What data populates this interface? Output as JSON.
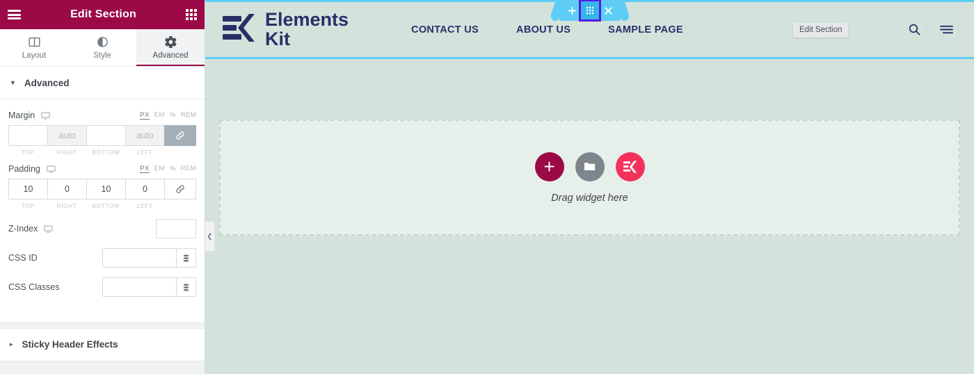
{
  "panel": {
    "header": {
      "title": "Edit Section",
      "menu_icon": "hamburger-icon",
      "widgets_icon": "grid-apps-icon"
    },
    "tabs": [
      {
        "label": "Layout",
        "icon": "columns-icon",
        "active": false
      },
      {
        "label": "Style",
        "icon": "contrast-icon",
        "active": false
      },
      {
        "label": "Advanced",
        "icon": "gear-icon",
        "active": true
      }
    ],
    "section": {
      "title": "Advanced",
      "caret": "▼"
    },
    "margin": {
      "label": "Margin",
      "units": [
        "PX",
        "EM",
        "%",
        "REM"
      ],
      "active_unit": "PX",
      "values": [
        "",
        "auto",
        "",
        "auto"
      ],
      "placeholders": [
        "",
        "auto",
        "",
        "auto"
      ],
      "sides": [
        "TOP",
        "RIGHT",
        "BOTTOM",
        "LEFT"
      ],
      "link_icon": "link-icon",
      "linked": true
    },
    "padding": {
      "label": "Padding",
      "units": [
        "PX",
        "EM",
        "%",
        "REM"
      ],
      "active_unit": "PX",
      "values": [
        "10",
        "0",
        "10",
        "0"
      ],
      "sides": [
        "TOP",
        "RIGHT",
        "BOTTOM",
        "LEFT"
      ],
      "link_icon": "link-icon",
      "linked": false
    },
    "zindex": {
      "label": "Z-Index",
      "value": ""
    },
    "css_id": {
      "label": "CSS ID",
      "value": "",
      "button_icon": "dynamic-tags-icon"
    },
    "css_classes": {
      "label": "CSS Classes",
      "value": "",
      "button_icon": "dynamic-tags-icon"
    },
    "sticky": {
      "title": "Sticky Header Effects",
      "caret": "▸"
    }
  },
  "preview": {
    "logo": {
      "line1": "Elements",
      "line2": "Kit",
      "mark": "elementskit-logo-icon"
    },
    "nav": [
      {
        "label": "CONTACT US"
      },
      {
        "label": "ABOUT US"
      },
      {
        "label": "SAMPLE PAGE"
      }
    ],
    "tools": [
      {
        "icon": "search-icon"
      },
      {
        "icon": "hamburger-menu-icon"
      }
    ],
    "section_toolbar": {
      "add_icon": "plus-icon",
      "edit_icon": "grid-dots-icon",
      "close_icon": "close-icon",
      "tooltip": "Edit Section"
    },
    "dropzone": {
      "label": "Drag widget here",
      "buttons": [
        {
          "icon": "plus-icon",
          "name": "add-widget-button"
        },
        {
          "icon": "folder-icon",
          "name": "template-library-button"
        },
        {
          "icon": "elementskit-icon",
          "name": "elementskit-widgets-button"
        }
      ]
    },
    "collapse_handle": {
      "icon": "chevron-left-icon",
      "glyph": "❮"
    }
  },
  "colors": {
    "panel_header": "#9b0a46",
    "accent_cyan": "#5ecdf5",
    "selection_purple": "#5718e8",
    "preview_bg": "#d3e3dc",
    "dropzone_bg": "#e7efea",
    "logo_navy": "#2b2e66",
    "ek_pink": "#f3315c"
  }
}
